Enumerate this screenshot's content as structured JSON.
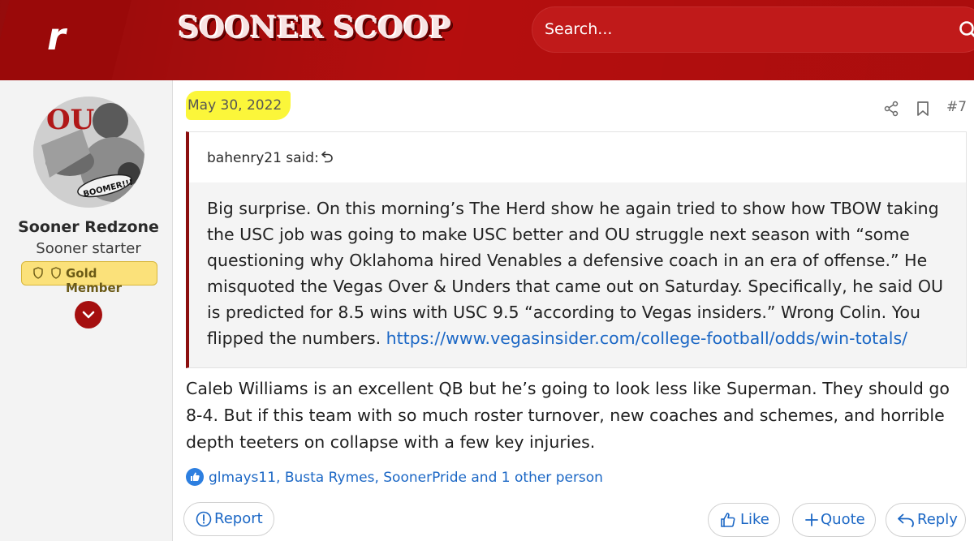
{
  "header": {
    "logo_letter": "r",
    "site_name": "SOONER SCOOP",
    "search_placeholder": "Search..."
  },
  "sidebar": {
    "username": "Sooner Redzone",
    "user_title": "Sooner starter",
    "badge": "Gold Member",
    "avatar_text": "BOOMER!!!"
  },
  "post": {
    "date": "May 30, 2022",
    "number": "#7",
    "quote": {
      "author": "bahenry21 said:",
      "text": "Big surprise. On this morning’s The Herd show he again tried to show how TBOW taking the USC job was going to make USC better and OU struggle next season with “some questioning why Oklahoma hired Venables a defensive coach in an era of offense.” He misquoted the Vegas Over & Unders that came out on Saturday. Specifically, he said OU is predicted for 8.5 wins with USC 9.5 “according to Vegas insiders.” Wrong Colin. You flipped the numbers. ",
      "link": "https://www.vegasinsider.com/college-football/odds/win-totals/"
    },
    "body": "Caleb Williams is an excellent QB but he’s going to look less like Superman. They should go 8-4. But if this team with so much roster turnover, new coaches and schemes, and horrible depth teeters on collapse with a few key injuries.",
    "reactions": "glmays11, Busta Rymes, SoonerPride and 1 other person",
    "actions": {
      "report": "Report",
      "like": "Like",
      "quote": "Quote",
      "reply": "Reply"
    }
  },
  "colors": {
    "header_red": "#b50e0e",
    "link_blue": "#1b67c5",
    "quote_bar": "#8b0f0f",
    "highlight_yellow": "#fbf63a",
    "badge_gold": "#fbe17a"
  },
  "icons": [
    "search-icon",
    "shield-icon",
    "chevron-down-icon",
    "share-icon",
    "bookmark-icon",
    "reply-arrow-icon",
    "thumbs-up-icon",
    "plus-icon",
    "alert-icon"
  ]
}
